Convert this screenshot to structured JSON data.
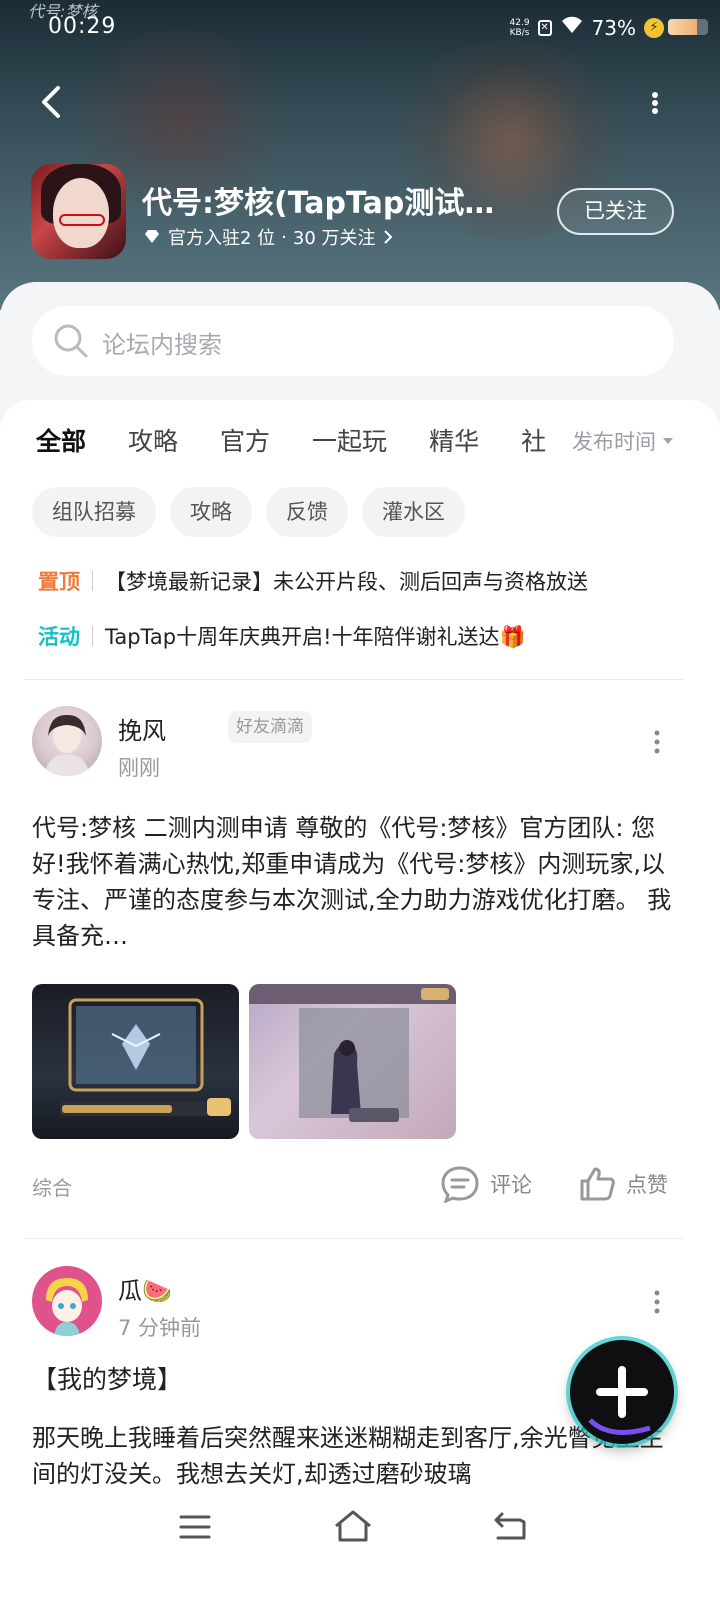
{
  "status_bar": {
    "time": "00:29",
    "logo_text": "代号:梦核",
    "net_speed": "42.9",
    "net_unit": "KB/s",
    "battery": "73%"
  },
  "header": {
    "game_title": "代号:梦核(TapTap测试…",
    "official_count": "官方入驻2 位",
    "dot": "·",
    "follows": "30 万关注",
    "follow_button": "已关注"
  },
  "search": {
    "placeholder": "论坛内搜索"
  },
  "tabs": [
    {
      "label": "全部"
    },
    {
      "label": "攻略"
    },
    {
      "label": "官方"
    },
    {
      "label": "一起玩"
    },
    {
      "label": "精华"
    },
    {
      "label": "社"
    }
  ],
  "sort": {
    "label": "发布时间"
  },
  "chips": [
    {
      "label": "组队招募"
    },
    {
      "label": "攻略"
    },
    {
      "label": "反馈"
    },
    {
      "label": "灌水区"
    }
  ],
  "notices": [
    {
      "tag": "置顶",
      "text": "【梦境最新记录】未公开片段、测后回声与资格放送",
      "color": "#f07a3c"
    },
    {
      "tag": "活动",
      "text": "TapTap十周年庆典开启!十年陪伴谢礼送达🎁",
      "color": "#15c1c5"
    }
  ],
  "posts": [
    {
      "username": "挽风",
      "badge": "好友滴滴",
      "time": "刚刚",
      "body": "代号:梦核 二测内测申请 尊敬的《代号:梦核》官方团队: 您好!我怀着满心热忱,郑重申请成为《代号:梦核》内测玩家,以专注、严谨的态度参与本次测试,全力助力游戏优化打磨。 我具备充…",
      "category": "综合",
      "comment": "评论",
      "like": "点赞"
    },
    {
      "username": "瓜🍉",
      "time": "7 分钟前",
      "title": "【我的梦境】",
      "body": "那天晚上我睡着后突然醒来迷迷糊糊走到客厅,余光瞥见卫生间的灯没关。我想去关灯,却透过磨砂玻璃"
    }
  ],
  "colors": {
    "accent": "#16c5c9",
    "pinned": "#f07a3c",
    "event": "#15c1c5"
  }
}
